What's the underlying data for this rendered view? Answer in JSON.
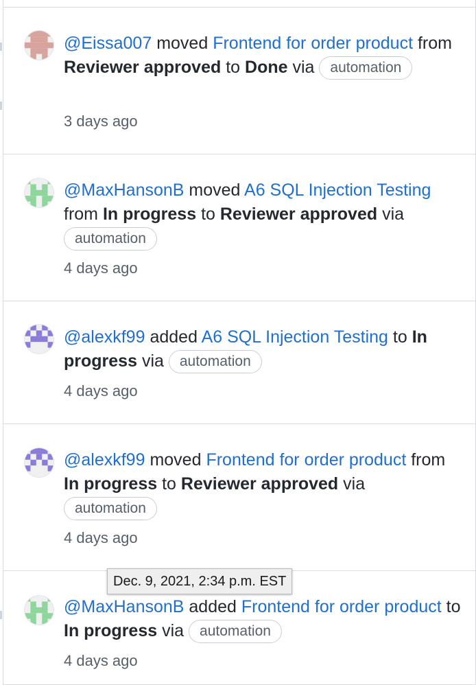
{
  "activities": [
    {
      "user": "@Eissa007",
      "verb": "moved",
      "card": "Frontend for order product",
      "from_word": "from",
      "from": "Reviewer approved",
      "to_word": "to",
      "to": "Done",
      "via_word": "via",
      "via": "automation",
      "time": "3 days ago",
      "avatar_color": "#d8a39c"
    },
    {
      "user": "@MaxHansonB",
      "verb": "moved",
      "card": "A6 SQL Injection Testing",
      "from_word": "from",
      "from": "In progress",
      "to_word": "to",
      "to": "Reviewer approved",
      "via_word": "via",
      "via": "automation",
      "time": "4 days ago",
      "avatar_color": "#8fd69c"
    },
    {
      "user": "@alexkf99",
      "verb": "added",
      "card": "A6 SQL Injection Testing",
      "to_word": "to",
      "to": "In progress",
      "via_word": "via",
      "via": "automation",
      "time": "4 days ago",
      "avatar_color": "#8c7bd8"
    },
    {
      "user": "@alexkf99",
      "verb": "moved",
      "card": "Frontend for order product",
      "from_word": "from",
      "from": "In progress",
      "to_word": "to",
      "to": "Reviewer approved",
      "via_word": "via",
      "via": "automation",
      "time": "4 days ago",
      "avatar_color": "#8c7bd8"
    },
    {
      "user": "@MaxHansonB",
      "verb": "added",
      "card": "Frontend for order product",
      "to_word": "to",
      "to": "In progress",
      "via_word": "via",
      "via": "automation",
      "time": "4 days ago",
      "avatar_color": "#8fd69c"
    }
  ],
  "tooltip": "Dec. 9, 2021, 2:34 p.m. EST",
  "colors": {
    "link": "#1f6fd0",
    "text": "#24292f",
    "muted": "#57606a",
    "border": "#d8dbe0"
  }
}
